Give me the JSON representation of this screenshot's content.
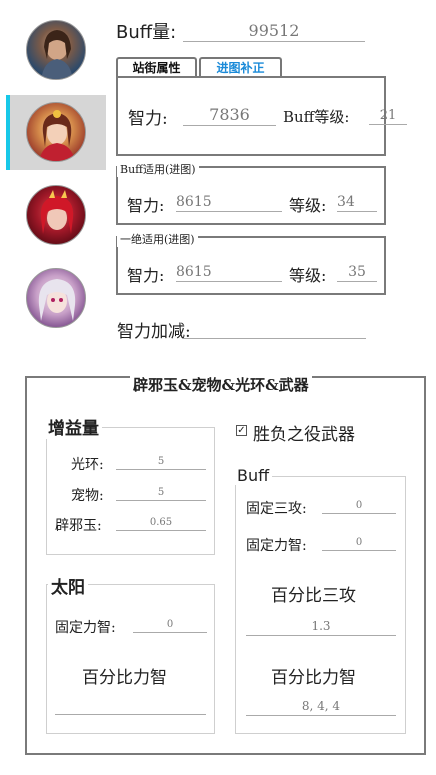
{
  "avatars": [
    "character-1",
    "character-2",
    "character-3",
    "character-4"
  ],
  "buff_amount": {
    "label": "Buff量:",
    "value": "99512"
  },
  "tabs": [
    {
      "label": "站街属性"
    },
    {
      "label": "进图补正"
    }
  ],
  "street": {
    "int_label": "智力:",
    "int_value": "7836",
    "level_label": "Buff等级:",
    "level_value": "21"
  },
  "buff_apply": {
    "legend": "Buff适用(进图)",
    "int_label": "智力:",
    "int_value": "8615",
    "level_label": "等级:",
    "level_value": "34"
  },
  "awaken_apply": {
    "legend": "一绝适用(进图)",
    "int_label": "智力:",
    "int_value": "8615",
    "level_label": "等级:",
    "level_value": "35"
  },
  "int_modifier": {
    "label": "智力加减:",
    "value": ""
  },
  "equip": {
    "legend": "辟邪玉&宠物&光环&武器",
    "gain": {
      "legend": "增益量",
      "aura_label": "光环:",
      "aura_value": "5",
      "pet_label": "宠物:",
      "pet_value": "5",
      "jade_label": "辟邪玉:",
      "jade_value": "0.65"
    },
    "weapon_checkbox": {
      "label": "胜负之役武器",
      "checked": true
    },
    "sun": {
      "legend": "太阳",
      "fixed_int_label": "固定力智:",
      "fixed_int_value": "0",
      "pct_int_label": "百分比力智",
      "pct_int_value": ""
    },
    "buff": {
      "legend": "Buff",
      "fixed_atk_label": "固定三攻:",
      "fixed_atk_value": "0",
      "fixed_int_label": "固定力智:",
      "fixed_int_value": "0",
      "pct_atk_label": "百分比三攻",
      "pct_atk_value": "1.3",
      "pct_int_label": "百分比力智",
      "pct_int_value": "8, 4, 4"
    }
  }
}
